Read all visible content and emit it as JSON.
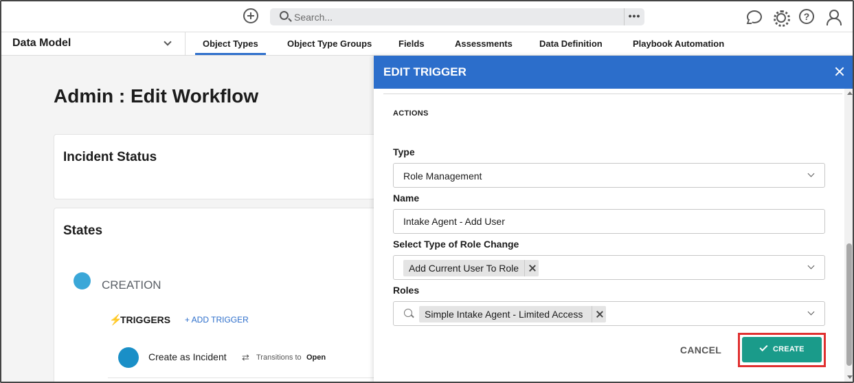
{
  "topbar": {
    "search_placeholder": "Search...",
    "more_label": "•••"
  },
  "subnav": {
    "model_label": "Data Model",
    "tabs": [
      {
        "label": "Object Types",
        "active": true
      },
      {
        "label": "Object Type Groups",
        "active": false
      },
      {
        "label": "Fields",
        "active": false
      },
      {
        "label": "Assessments",
        "active": false
      },
      {
        "label": "Data Definition",
        "active": false
      },
      {
        "label": "Playbook Automation",
        "active": false
      }
    ]
  },
  "page": {
    "title": "Admin : Edit Workflow",
    "status_card_title": "Incident Status",
    "states_card_title": "States",
    "state_name": "CREATION",
    "triggers_label": "TRIGGERS",
    "add_trigger_label": "+ ADD TRIGGER",
    "trigger_name": "Create as Incident",
    "transition_text": "Transitions to",
    "transition_target": "Open"
  },
  "modal": {
    "title": "EDIT TRIGGER",
    "section_label": "ACTIONS",
    "type_label": "Type",
    "type_value": "Role Management",
    "name_label": "Name",
    "name_value": "Intake Agent - Add User",
    "role_change_label": "Select Type of Role Change",
    "role_change_tag": "Add Current User To Role",
    "roles_label": "Roles",
    "roles_tag": "Simple Intake Agent - Limited Access",
    "cancel_label": "CANCEL",
    "create_label": "CREATE"
  },
  "colors": {
    "accent": "#2c6ecb",
    "create_button": "#1a9b8a",
    "highlight": "#e03030",
    "state_dot": "#3aa7d8"
  },
  "icons": [
    "plus-circle-icon",
    "search-icon",
    "chat-icon",
    "gear-icon",
    "help-icon",
    "user-icon",
    "chevron-down-icon",
    "close-icon",
    "bolt-icon",
    "transition-icon",
    "check-icon"
  ]
}
